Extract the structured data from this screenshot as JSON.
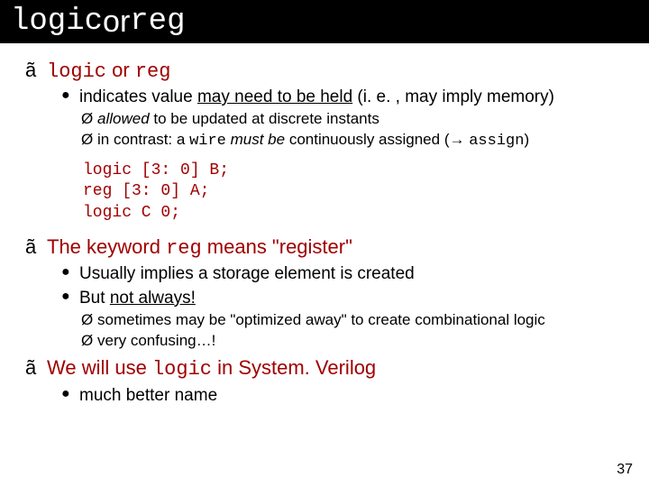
{
  "title": {
    "p1": "logic",
    "p2": " or ",
    "p3": "reg"
  },
  "b1": {
    "l1": {
      "p1": "logic",
      "p2": " or ",
      "p3": "reg"
    },
    "l2": {
      "t1": "indicates value ",
      "t2": "may need to be held",
      "t3": " (i. e. , may imply memory)"
    },
    "l3a": {
      "t1": "allowed",
      "t2": " to be updated at discrete instants"
    },
    "l3b": {
      "t1": "in contrast: a ",
      "t2": "wire",
      "t3": " ",
      "t4": "must be",
      "t5": " continuously assigned (",
      "arrow": "→",
      "t6": " ",
      "t7": "assign",
      "t8": ")"
    }
  },
  "code": {
    "l1": "logic [3: 0] B;",
    "l2": "reg [3: 0] A;",
    "l3": "logic C 0;"
  },
  "b2": {
    "l1": {
      "t1": "The keyword ",
      "t2": "reg",
      "t3": " means \"register\""
    },
    "l2a": "Usually implies a storage element is created",
    "l2b": {
      "t1": "But ",
      "t2": "not always!"
    },
    "l3a": "sometimes may be \"optimized away\" to create combinational logic",
    "l3b": "very confusing…!"
  },
  "b3": {
    "l1": {
      "t1": "We will use ",
      "t2": "logic",
      "t3": " in System. Verilog"
    },
    "l2": "much better name"
  },
  "page": "37"
}
